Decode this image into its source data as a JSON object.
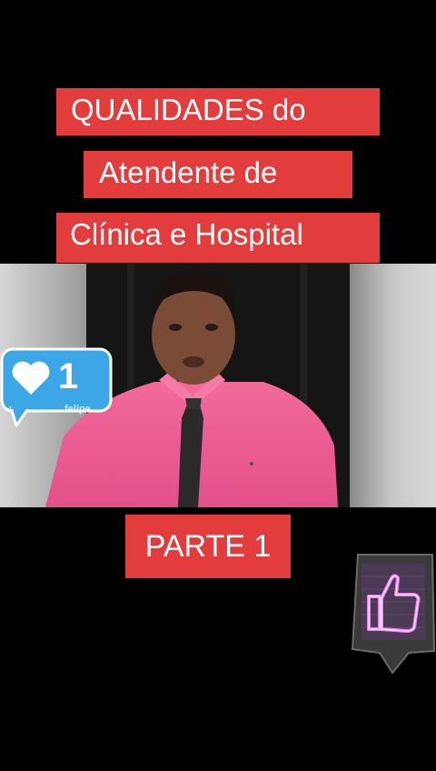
{
  "title": {
    "line1": "QUALIDADES do",
    "line2": "Atendente de",
    "line3": "Clínica e Hospital"
  },
  "video": {
    "watermark": "…felipe"
  },
  "like_badge": {
    "icon": "heart-icon",
    "count": "1",
    "color": "#3ba7e6"
  },
  "part_label": "PARTE 1",
  "thumbs_up_sticker": {
    "icon": "thumbs-up-icon",
    "glow_color": "#e040ff"
  },
  "colors": {
    "title_background": "#e23c3c",
    "page_background": "#000000"
  }
}
